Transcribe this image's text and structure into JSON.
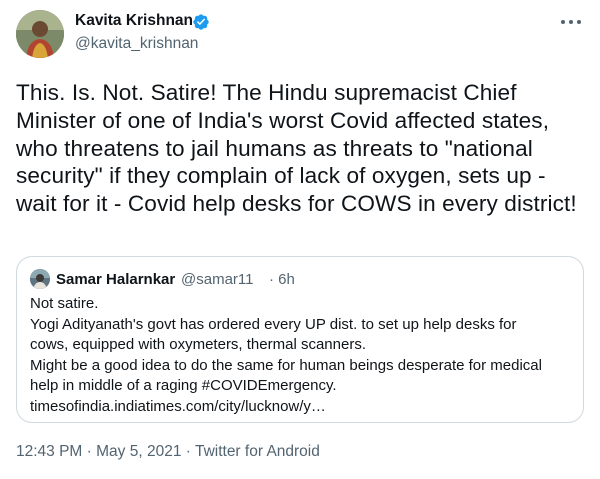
{
  "author": {
    "name": "Kavita Krishnan",
    "handle": "@kavita_krishnan",
    "verified_icon": "verified-badge-icon",
    "avatar_icon": "profile-avatar"
  },
  "tweet": {
    "text": "This. Is. Not. Satire! The Hindu supremacist Chief Minister of one of India's worst Covid affected states, who threatens to jail humans as threats to \"national security\" if they complain of lack of oxygen, sets up - wait for it - Covid help desks for COWS in every district!"
  },
  "quoted_tweet": {
    "name": "Samar Halarnkar",
    "handle": "@samar11",
    "time": "· 6h",
    "lines": [
      "Not satire.",
      "Yogi Adityanath's govt has ordered every UP dist. to set up help desks for",
      "cows, equipped with oxymeters, thermal scanners.",
      "Might be a good idea to do the same for human beings desperate for medical",
      "help in middle of a raging #COVIDEmergency.",
      "timesofindia.indiatimes.com/city/lucknow/y…"
    ]
  },
  "meta": {
    "time": "12:43 PM",
    "separator": " · ",
    "date": "May 5, 2021",
    "source": "Twitter for Android"
  },
  "colors": {
    "text": "#0f1419",
    "secondary": "#536471",
    "verified": "#1d9bf0",
    "border": "#cfd9de"
  }
}
